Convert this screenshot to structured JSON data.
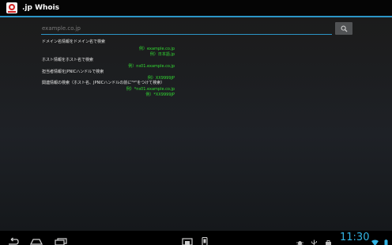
{
  "app": {
    "title": ".jp Whois",
    "icon": "whois-app-icon"
  },
  "search": {
    "placeholder": "example.co.jp",
    "value": "",
    "button_icon": "search-icon"
  },
  "hints": [
    {
      "label": "ドメイン名情報をドメイン名で検索",
      "examples": [
        "例）example.co.jp",
        "例）日本語.jp"
      ]
    },
    {
      "label": "ホスト情報をホスト名で検索",
      "examples": [
        "例）ns01.example.co.jp"
      ]
    },
    {
      "label": "担当者情報をJPNICハンドルで検索",
      "examples": [
        "例）XX9999JP"
      ]
    },
    {
      "label": "関連情報の検索（ホスト名、JPNICハンドルの前に\"*\"をつけて検索）",
      "examples": [
        "例）*ns01.example.co.jp",
        "例）*XX9999JP"
      ]
    }
  ],
  "status_bar": {
    "time": "11:30"
  },
  "colors": {
    "accent": "#33b5e5",
    "example_text": "#33dd33",
    "underline": "#2c95c7"
  }
}
